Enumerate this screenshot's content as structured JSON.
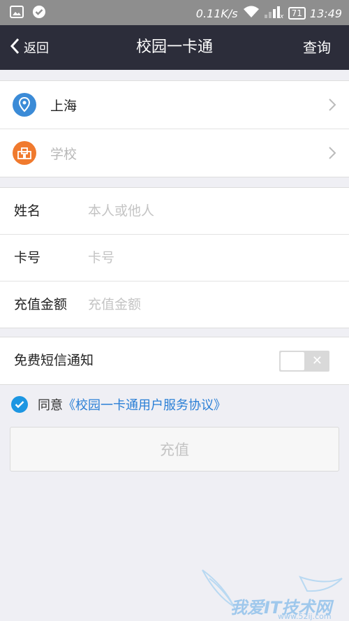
{
  "status_bar": {
    "net_speed": "0.11K/s",
    "battery": "71",
    "time": "13:49",
    "icons": [
      "image-icon",
      "check-circle-icon",
      "wifi-icon",
      "signal-icon",
      "battery-icon"
    ]
  },
  "nav": {
    "back_label": "返回",
    "title": "校园一卡通",
    "query_label": "查询"
  },
  "location": {
    "city": "上海",
    "school_placeholder": "学校",
    "city_icon_color": "#3b8bd7",
    "school_icon_color": "#f07a2e"
  },
  "form": {
    "name_label": "姓名",
    "name_placeholder": "本人或他人",
    "card_label": "卡号",
    "card_placeholder": "卡号",
    "amount_label": "充值金额",
    "amount_placeholder": "充值金额"
  },
  "sms": {
    "label": "免费短信通知",
    "enabled": false
  },
  "agreement": {
    "prefix": "同意",
    "link": "《校园一卡通用户服务协议》",
    "checked": true
  },
  "submit_label": "充值",
  "watermark": {
    "text": "我爱IT技术网",
    "url": "www.52ij.com"
  },
  "colors": {
    "nav_bg": "#2c2d3a",
    "accent": "#1c96e2",
    "link": "#2a7fd6"
  }
}
